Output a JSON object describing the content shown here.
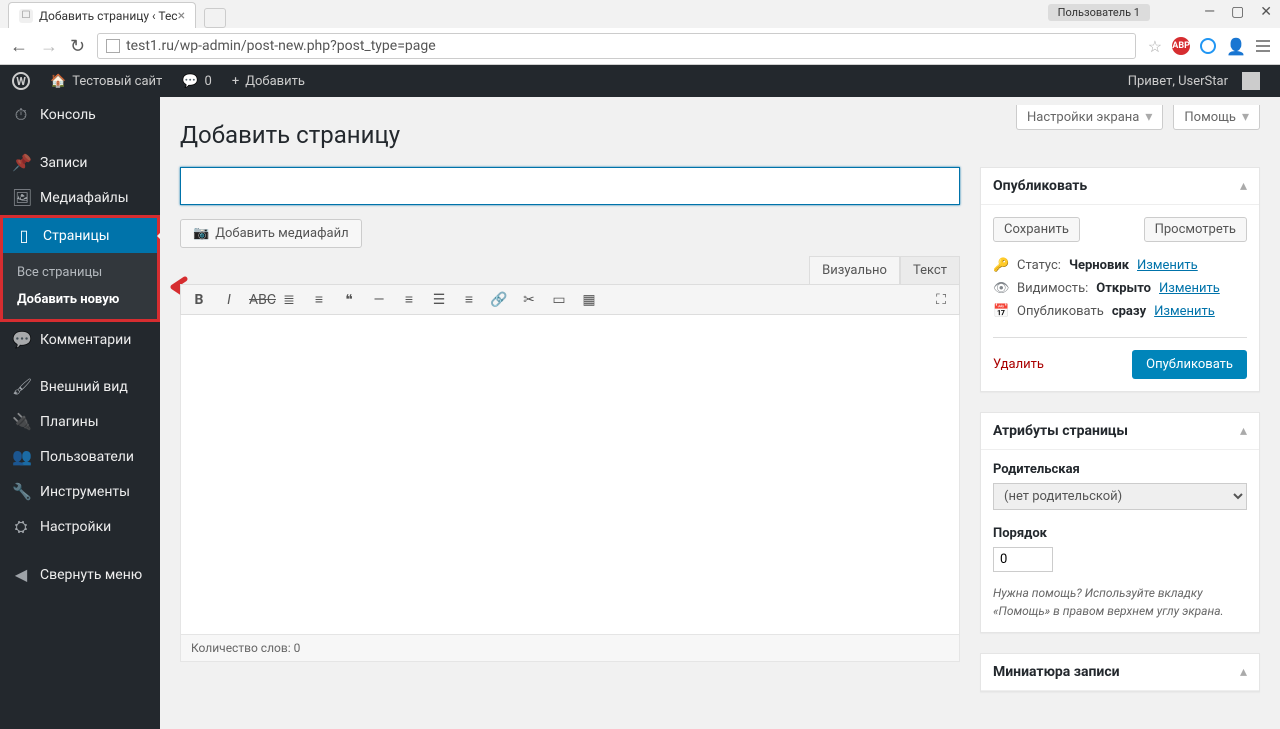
{
  "browser": {
    "tab_title": "Добавить страницу ‹ Тес",
    "user_badge": "Пользователь 1",
    "url": "test1.ru/wp-admin/post-new.php?post_type=page"
  },
  "adminbar": {
    "site": "Тестовый сайт",
    "comments": "0",
    "new": "Добавить",
    "greeting": "Привет, UserStar"
  },
  "sidebar": {
    "items": [
      {
        "label": "Консоль"
      },
      {
        "label": "Записи"
      },
      {
        "label": "Медиафайлы"
      },
      {
        "label": "Страницы"
      },
      {
        "label": "Комментарии"
      },
      {
        "label": "Внешний вид"
      },
      {
        "label": "Плагины"
      },
      {
        "label": "Пользователи"
      },
      {
        "label": "Инструменты"
      },
      {
        "label": "Настройки"
      },
      {
        "label": "Свернуть меню"
      }
    ],
    "sub": {
      "all": "Все страницы",
      "add": "Добавить новую"
    }
  },
  "screen": {
    "options": "Настройки экрана",
    "help": "Помощь"
  },
  "page": {
    "heading": "Добавить страницу",
    "title_value": "",
    "add_media": "Добавить медиафайл",
    "tab_visual": "Визуально",
    "tab_text": "Текст",
    "word_count": "Количество слов: 0"
  },
  "publish": {
    "title": "Опубликовать",
    "save": "Сохранить",
    "preview": "Просмотреть",
    "status_label": "Статус:",
    "status_value": "Черновик",
    "edit": "Изменить",
    "visibility_label": "Видимость:",
    "visibility_value": "Открыто",
    "schedule_label": "Опубликовать",
    "schedule_value": "сразу",
    "delete": "Удалить",
    "button": "Опубликовать"
  },
  "attrs": {
    "title": "Атрибуты страницы",
    "parent_label": "Родительская",
    "parent_select": "(нет родительской)",
    "order_label": "Порядок",
    "order_value": "0",
    "help": "Нужна помощь? Используйте вкладку «Помощь» в правом верхнем углу экрана."
  },
  "thumb": {
    "title": "Миниатюра записи"
  }
}
